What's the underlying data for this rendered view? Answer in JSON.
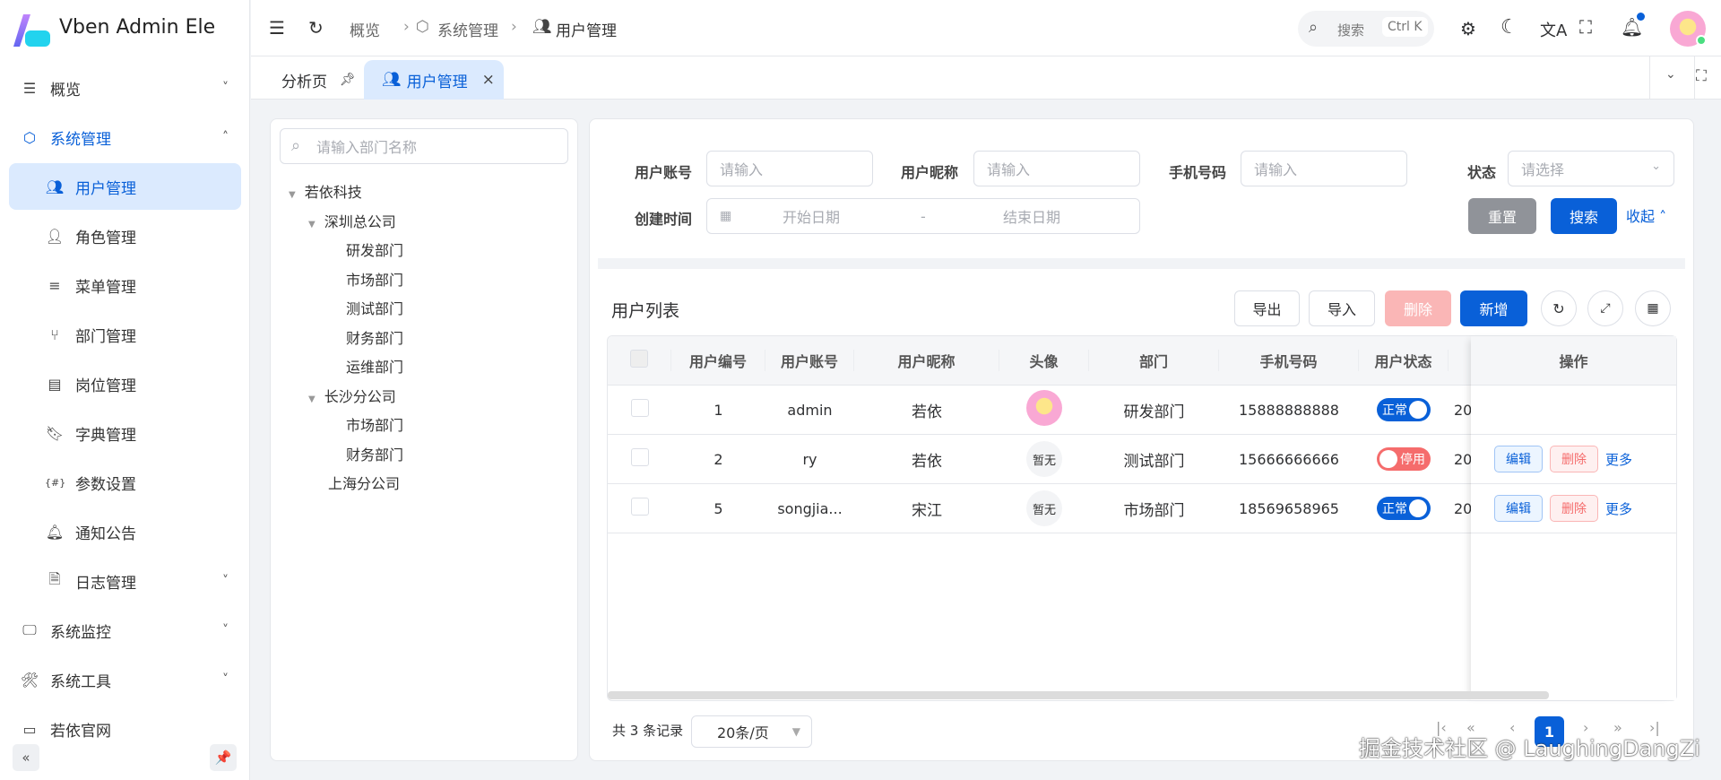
{
  "app": {
    "title": "Vben Admin Ele"
  },
  "colors": {
    "primary": "#0960d8",
    "danger": "#f56c6c",
    "active_bg": "#dbeafe"
  },
  "sidebar": {
    "items": [
      {
        "label": "概览",
        "icon": "menu-icon",
        "chevron": "down"
      },
      {
        "label": "系统管理",
        "icon": "system-icon",
        "chevron": "up"
      },
      {
        "label": "用户管理",
        "icon": "users-icon",
        "active": true
      },
      {
        "label": "角色管理",
        "icon": "role-icon"
      },
      {
        "label": "菜单管理",
        "icon": "list-icon"
      },
      {
        "label": "部门管理",
        "icon": "dept-icon"
      },
      {
        "label": "岗位管理",
        "icon": "post-icon"
      },
      {
        "label": "字典管理",
        "icon": "bookmark-icon"
      },
      {
        "label": "参数设置",
        "icon": "braces-icon"
      },
      {
        "label": "通知公告",
        "icon": "bell-icon"
      },
      {
        "label": "日志管理",
        "icon": "log-icon",
        "chevron": "down"
      },
      {
        "label": "系统监控",
        "icon": "monitor-icon",
        "chevron": "down"
      },
      {
        "label": "系统工具",
        "icon": "tool-icon",
        "chevron": "down"
      },
      {
        "label": "若依官网",
        "icon": "link-icon"
      }
    ],
    "collapse": "«",
    "pin": "pin-icon"
  },
  "header": {
    "breadcrumb": [
      "概览",
      "系统管理",
      "用户管理"
    ],
    "search_label": "搜索",
    "search_shortcut": "Ctrl K"
  },
  "tabs": [
    {
      "label": "分析页",
      "pinned": true
    },
    {
      "label": "用户管理",
      "active": true,
      "close": "×"
    }
  ],
  "tree": {
    "placeholder": "请输入部门名称",
    "nodes": [
      {
        "label": "若依科技",
        "level": 0,
        "expanded": true
      },
      {
        "label": "深圳总公司",
        "level": 1,
        "expanded": true
      },
      {
        "label": "研发部门",
        "level": 2
      },
      {
        "label": "市场部门",
        "level": 2
      },
      {
        "label": "测试部门",
        "level": 2
      },
      {
        "label": "财务部门",
        "level": 2
      },
      {
        "label": "运维部门",
        "level": 2
      },
      {
        "label": "长沙分公司",
        "level": 1,
        "expanded": true
      },
      {
        "label": "市场部门",
        "level": 2
      },
      {
        "label": "财务部门",
        "level": 2
      },
      {
        "label": "上海分公司",
        "level": 1
      }
    ]
  },
  "form": {
    "account_label": "用户账号",
    "account_ph": "请输入",
    "nickname_label": "用户昵称",
    "nickname_ph": "请输入",
    "phone_label": "手机号码",
    "phone_ph": "请输入",
    "status_label": "状态",
    "status_ph": "请选择",
    "time_label": "创建时间",
    "start_ph": "开始日期",
    "sep": "-",
    "end_ph": "结束日期",
    "reset": "重置",
    "search": "搜索",
    "collapse": "收起"
  },
  "toolbar": {
    "title": "用户列表",
    "export": "导出",
    "import": "导入",
    "delete": "删除",
    "add": "新增"
  },
  "table": {
    "columns": [
      "用户编号",
      "用户账号",
      "用户昵称",
      "头像",
      "部门",
      "手机号码",
      "用户状态",
      "操作"
    ],
    "rows": [
      {
        "id": "1",
        "account": "admin",
        "nickname": "若依",
        "avatar": "",
        "dept": "研发部门",
        "phone": "15888888888",
        "status": "正常",
        "on": true,
        "created": "20",
        "actions": false
      },
      {
        "id": "2",
        "account": "ry",
        "nickname": "若依",
        "avatar": "暂无",
        "dept": "测试部门",
        "phone": "15666666666",
        "status": "停用",
        "on": false,
        "created": "20",
        "actions": true
      },
      {
        "id": "5",
        "account": "songjia...",
        "nickname": "宋江",
        "avatar": "暂无",
        "dept": "市场部门",
        "phone": "18569658965",
        "status": "正常",
        "on": true,
        "created": "20",
        "actions": true
      }
    ],
    "actions": {
      "edit": "编辑",
      "delete": "删除",
      "more": "更多"
    }
  },
  "pagination": {
    "total": "共 3 条记录",
    "page_size": "20条/页",
    "current": "1"
  },
  "watermark": "掘金技术社区 @ LaughingDangZi"
}
